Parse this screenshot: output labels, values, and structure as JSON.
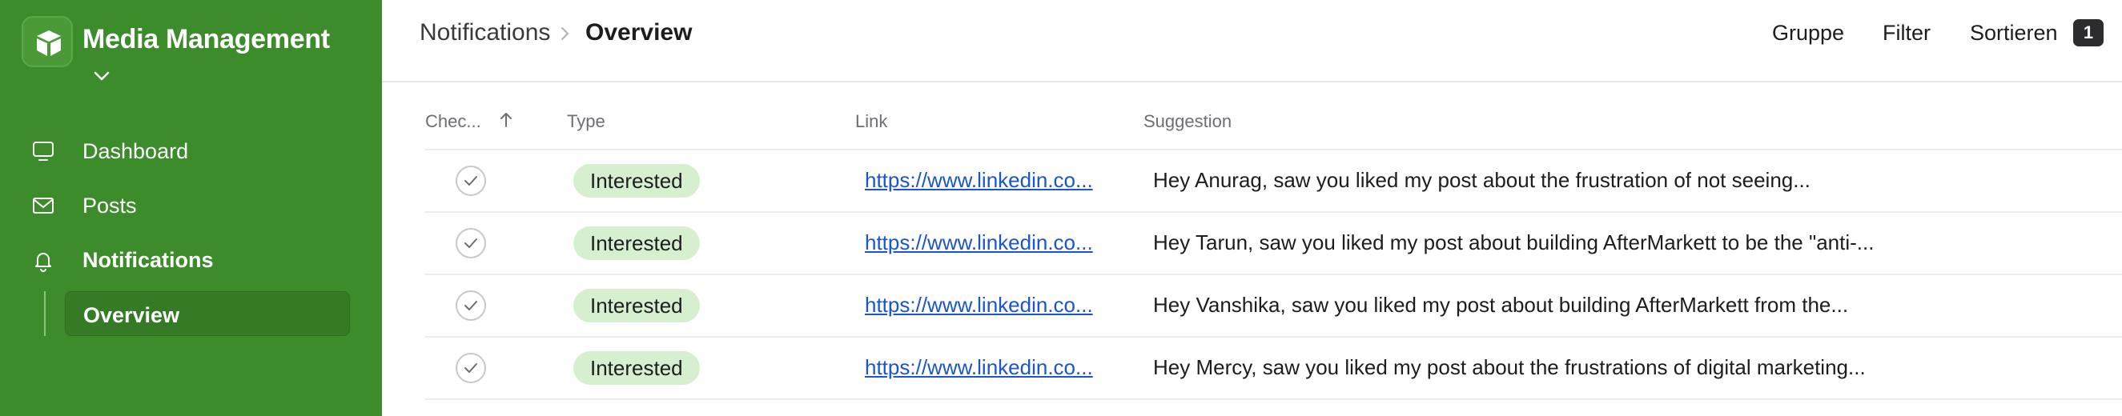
{
  "app": {
    "title": "Media Management",
    "brand_color": "#3d8c2c"
  },
  "sidebar": {
    "items": [
      {
        "label": "Dashboard",
        "icon": "monitor-icon"
      },
      {
        "label": "Posts",
        "icon": "envelope-icon"
      },
      {
        "label": "Notifications",
        "icon": "bell-icon"
      }
    ],
    "sub_items": [
      {
        "label": "Overview"
      }
    ]
  },
  "header": {
    "breadcrumb": [
      "Notifications",
      "Overview"
    ],
    "group_label": "Gruppe",
    "filter_label": "Filter",
    "sort_label": "Sortieren",
    "sort_count": "1"
  },
  "table": {
    "columns": [
      "Chec...",
      "Type",
      "Link",
      "Suggestion"
    ],
    "rows": [
      {
        "type": "Interested",
        "link": "https://www.linkedin.co...",
        "suggestion": "Hey Anurag, saw you liked my post about the frustration of not seeing..."
      },
      {
        "type": "Interested",
        "link": "https://www.linkedin.co...",
        "suggestion": "Hey Tarun, saw you liked my post about building AfterMarkett to be the \"anti-..."
      },
      {
        "type": "Interested",
        "link": "https://www.linkedin.co...",
        "suggestion": "Hey Vanshika, saw you liked my post about building AfterMarkett from the..."
      },
      {
        "type": "Interested",
        "link": "https://www.linkedin.co...",
        "suggestion": "Hey Mercy, saw you liked my post about the frustrations of digital marketing..."
      }
    ]
  }
}
